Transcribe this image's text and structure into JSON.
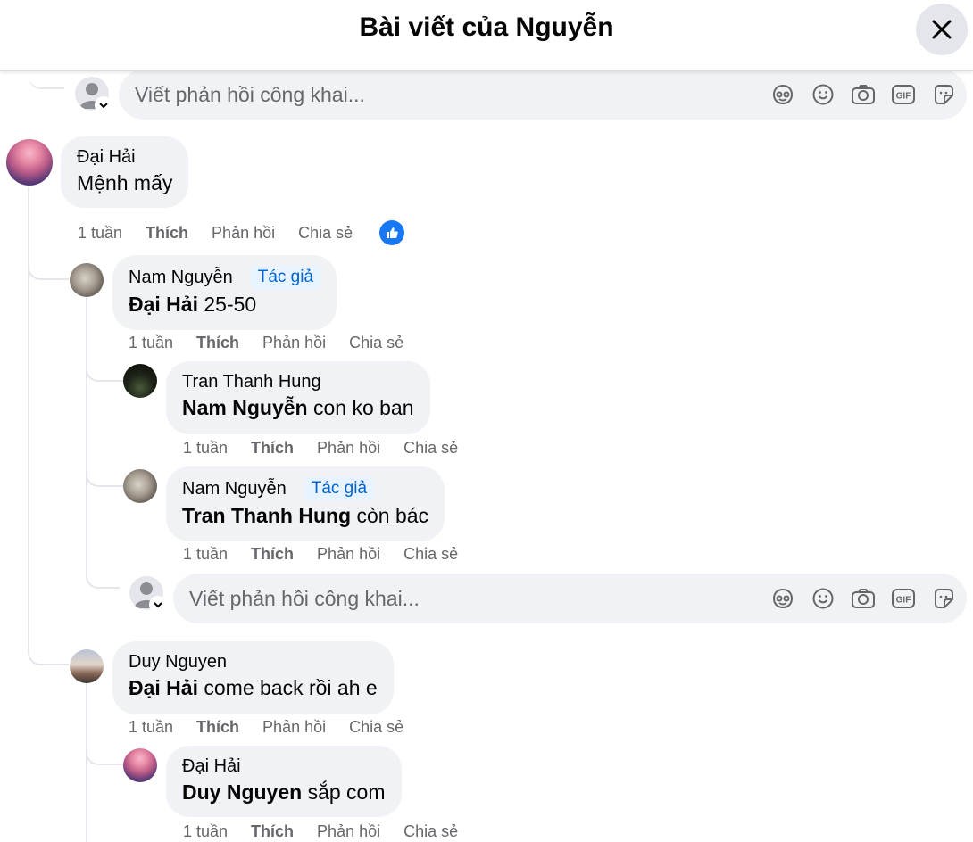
{
  "header": {
    "title": "Bài viết của Nguyễn"
  },
  "reply_placeholder": "Viết phản hồi công khai...",
  "badge_label": "Tác giả",
  "comments": [
    {
      "author": "Đại Hải",
      "mention": "",
      "text": "Mệnh mấy",
      "time": "1 tuần",
      "like": "Thích",
      "reply": "Phản hồi",
      "share": "Chia sẻ"
    },
    {
      "author": "Nam Nguyễn",
      "mention": "Đại Hải",
      "text": " 25-50",
      "time": "1 tuần",
      "like": "Thích",
      "reply": "Phản hồi",
      "share": "Chia sẻ"
    },
    {
      "author": "Tran Thanh Hung",
      "mention": "Nam Nguyễn",
      "text": " con ko ban",
      "time": "1 tuần",
      "like": "Thích",
      "reply": "Phản hồi",
      "share": "Chia sẻ"
    },
    {
      "author": "Nam Nguyễn",
      "mention": "Tran Thanh Hung",
      "text": " còn bác",
      "time": "1 tuần",
      "like": "Thích",
      "reply": "Phản hồi",
      "share": "Chia sẻ"
    },
    {
      "author": "Duy Nguyen",
      "mention": "Đại Hải",
      "text": " come back rồi ah e",
      "time": "1 tuần",
      "like": "Thích",
      "reply": "Phản hồi",
      "share": "Chia sẻ"
    },
    {
      "author": "Đại Hải",
      "mention": "Duy Nguyen",
      "text": " sắp com",
      "time": "1 tuần",
      "like": "Thích",
      "reply": "Phản hồi",
      "share": "Chia sẻ"
    }
  ],
  "icons": [
    "avatar-frame-icon",
    "emoji-icon",
    "camera-icon",
    "gif-icon",
    "sticker-icon",
    "like-reaction-icon",
    "close-icon"
  ],
  "colors": {
    "accent": "#1877f2",
    "author_badge": "#0064d1",
    "bubble": "#f0f2f5",
    "secondary_text": "#65676b"
  }
}
